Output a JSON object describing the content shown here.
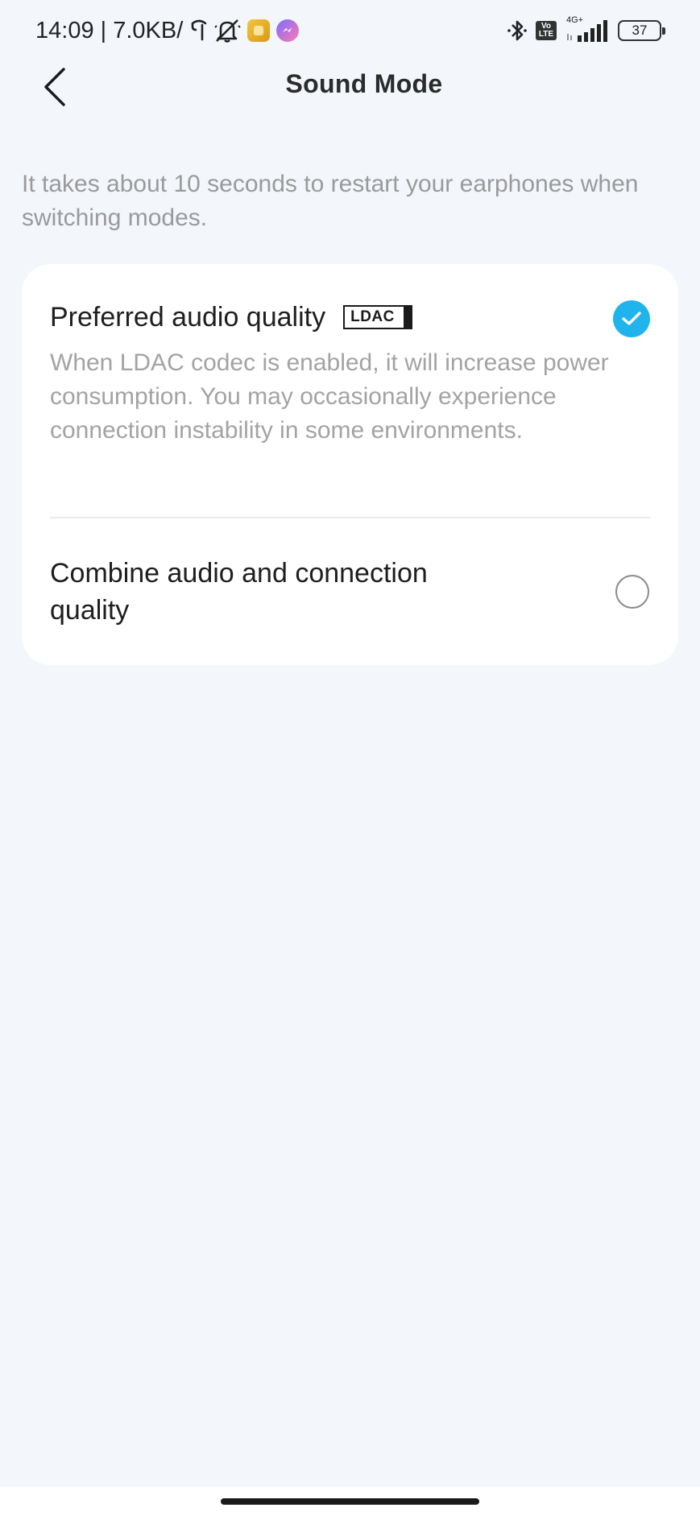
{
  "status_bar": {
    "time_speed": "14:09 | 7.0KB/",
    "network_type": "4G+",
    "volte": "Vo LTE",
    "battery_level": "37"
  },
  "header": {
    "title": "Sound Mode",
    "back_icon": "chevron-left-icon"
  },
  "intro": {
    "text": "It takes about 10 seconds to restart your earphones when switching modes."
  },
  "options": [
    {
      "title": "Preferred audio quality",
      "badge": "LDAC",
      "description": "When LDAC codec is enabled, it will increase power consumption. You may occasionally experience connection instability in some environments.",
      "selected": true
    },
    {
      "title": "Combine audio and connection quality",
      "selected": false
    }
  ],
  "colors": {
    "accent": "#1fb4ec",
    "background": "#f3f6fb",
    "card": "#ffffff",
    "secondary_text": "#a3a3a3"
  }
}
